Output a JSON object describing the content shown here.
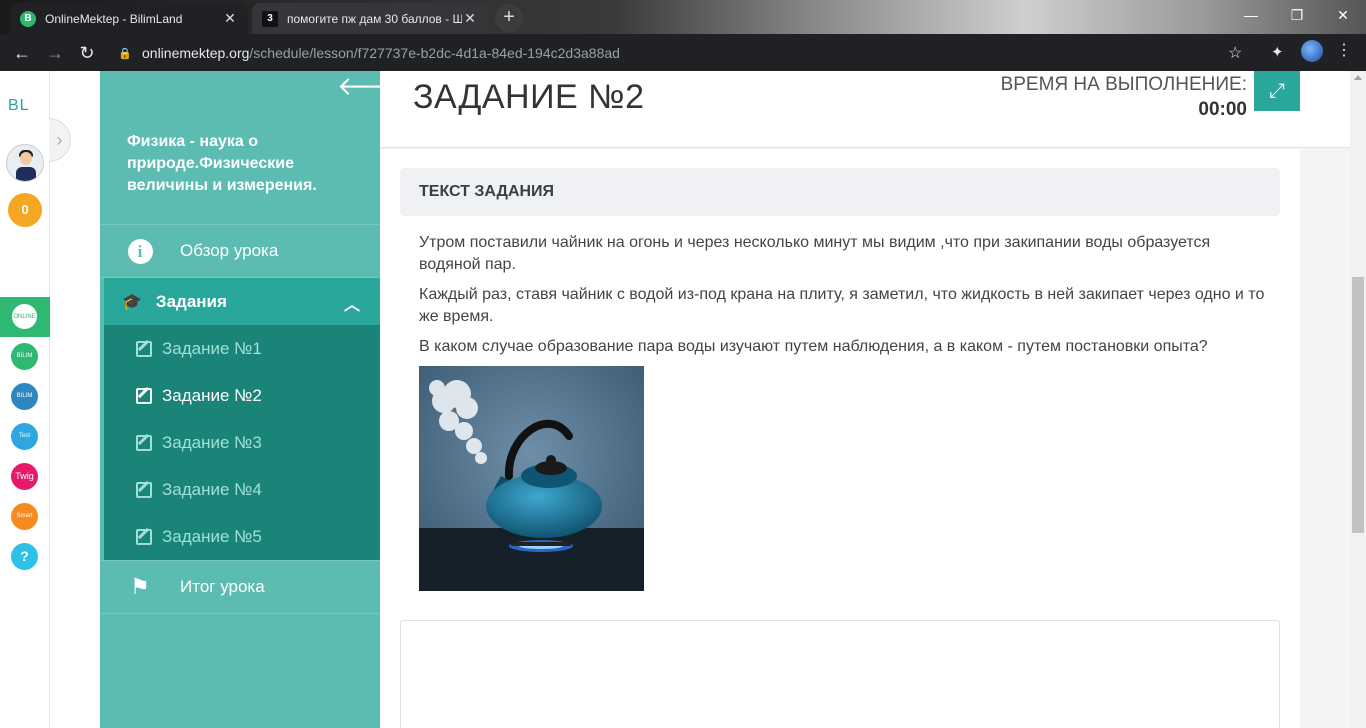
{
  "browser": {
    "tabs": [
      {
        "title": "OnlineMektep - BilimLand",
        "favicon": "B",
        "active": true
      },
      {
        "title": "помогите пж дам 30 баллов - Ш",
        "favicon": "3",
        "active": false
      }
    ],
    "url_host": "onlinemektep.org",
    "url_path": "/schedule/lesson/f727737e-b2dc-4d1a-84ed-194c2d3a88ad"
  },
  "rail": {
    "logo": "BL",
    "coins": "0",
    "apps": [
      {
        "name": "onlinemektep",
        "label": "ONLINE MEKTEP",
        "color": "#2eb872"
      },
      {
        "name": "bilimland",
        "label": "BILIM Land",
        "color": "#2eb872"
      },
      {
        "name": "bilimbook",
        "label": "BILIM Book",
        "color": "#2e86c1"
      },
      {
        "name": "bilimtest",
        "label": "Test",
        "color": "#2ea7e0"
      },
      {
        "name": "twig",
        "label": "Twig",
        "color": "#e6196b"
      },
      {
        "name": "bilimsmart",
        "label": "Smart",
        "color": "#f58a1f"
      },
      {
        "name": "help",
        "label": "?",
        "color": "#2ec1e8"
      }
    ]
  },
  "sidebar": {
    "lesson_title": "Физика - наука о природе.Физические величины и измерения.",
    "overview_label": "Обзор урока",
    "tasks_label": "Задания",
    "tasks": [
      {
        "label": "Задание №1",
        "current": false
      },
      {
        "label": "Задание №2",
        "current": true
      },
      {
        "label": "Задание №3",
        "current": false
      },
      {
        "label": "Задание №4",
        "current": false
      },
      {
        "label": "Задание №5",
        "current": false
      }
    ],
    "summary_label": "Итог урока"
  },
  "main": {
    "title": "ЗАДАНИЕ №2",
    "timer_label": "ВРЕМЯ НА ВЫПОЛНЕНИЕ:",
    "timer_value": "00:00",
    "task_header": "ТЕКСТ ЗАДАНИЯ",
    "paragraphs": [
      "Утром поставили чайник на огонь и через несколько минут мы видим ,что при закипании воды образуется водяной пар.",
      "Каждый раз, ставя чайник с водой из-под крана на плиту, я заметил, что жидкость в ней закипает через одно и то же время.",
      "В каком случае образование пара воды изучают путем наблюдения, а в каком - путем постановки опыта?"
    ]
  },
  "colors": {
    "sidebar_bg": "#5cbcb2",
    "accent": "#2aa79b",
    "task_list_bg": "#1a8478"
  }
}
